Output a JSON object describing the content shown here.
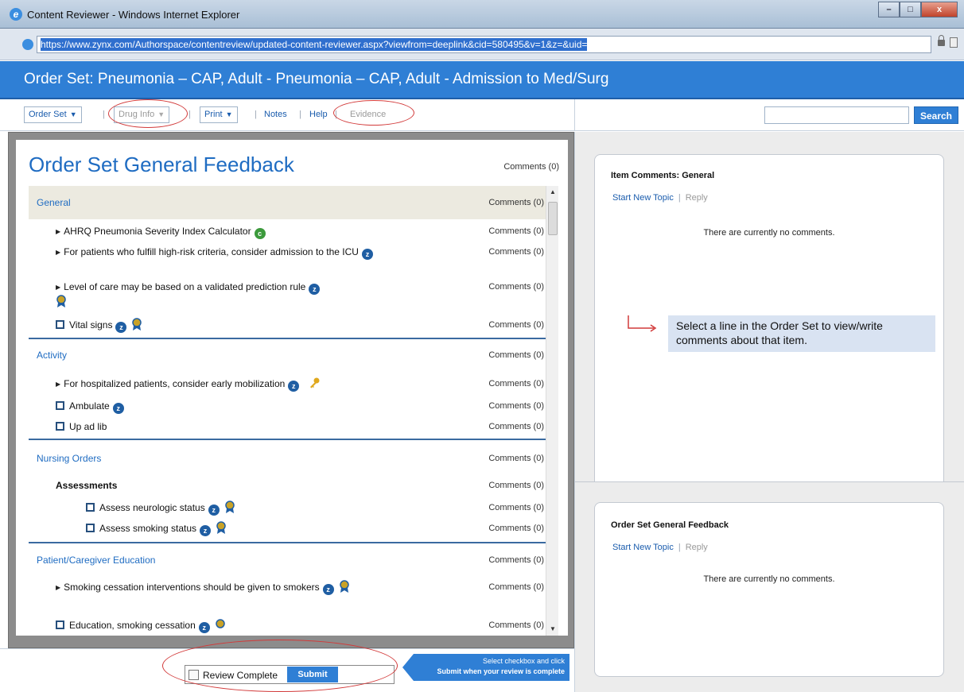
{
  "window": {
    "title": "Content Reviewer - Windows Internet Explorer",
    "url": "https://www.zynx.com/Authorspace/contentreview/updated-content-reviewer.aspx?viewfrom=deeplink&cid=580495&v=1&z=&uid=",
    "min_label": "–",
    "max_label": "□",
    "close_label": "x"
  },
  "header": {
    "title": "Order Set: Pneumonia – CAP, Adult - Pneumonia – CAP, Adult - Admission to Med/Surg"
  },
  "toolbar": {
    "order_set": "Order Set",
    "drug_info": "Drug Info",
    "print": "Print",
    "notes": "Notes",
    "help": "Help",
    "evidence": "Evidence",
    "sep": "|",
    "search_label": "Search"
  },
  "left": {
    "heading": "Order Set General Feedback",
    "heading_comments": "Comments (0)",
    "rows": [
      {
        "kind": "section",
        "text": "General",
        "comments": "Comments (0)"
      },
      {
        "kind": "item",
        "text": "AHRQ Pneumonia Severity Index Calculator",
        "comments": "Comments (0)"
      },
      {
        "kind": "item",
        "text": "For patients who fulfill high-risk criteria, consider admission to the ICU",
        "comments": "Comments (0)"
      },
      {
        "kind": "item",
        "text": "Level of care may be based on a validated prediction rule",
        "comments": "Comments (0)"
      },
      {
        "kind": "check",
        "text": "Vital signs",
        "comments": "Comments (0)"
      },
      {
        "kind": "section",
        "text": "Activity",
        "comments": "Comments (0)"
      },
      {
        "kind": "item",
        "text": "For hospitalized patients, consider early mobilization",
        "comments": "Comments (0)"
      },
      {
        "kind": "check",
        "text": "Ambulate",
        "comments": "Comments (0)"
      },
      {
        "kind": "check",
        "text": "Up ad lib",
        "comments": "Comments (0)"
      },
      {
        "kind": "section",
        "text": "Nursing Orders",
        "comments": "Comments (0)"
      },
      {
        "kind": "subhead",
        "text": "Assessments",
        "comments": "Comments (0)"
      },
      {
        "kind": "check",
        "text": "Assess neurologic status",
        "comments": "Comments (0)"
      },
      {
        "kind": "check",
        "text": "Assess smoking status",
        "comments": "Comments (0)"
      },
      {
        "kind": "section",
        "text": "Patient/Caregiver Education",
        "comments": "Comments (0)"
      },
      {
        "kind": "item",
        "text": "Smoking cessation interventions should be given to smokers",
        "comments": "Comments (0)"
      },
      {
        "kind": "check",
        "text": "Education, smoking cessation",
        "comments": "Comments (0)"
      }
    ],
    "badge_z": "z",
    "badge_c": "c"
  },
  "bottom": {
    "review_complete": "Review Complete",
    "submit": "Submit",
    "hint_line1": "Select checkbox and click",
    "hint_line2": "Submit when your review is complete"
  },
  "right": {
    "item_comments_title": "Item Comments: General",
    "start_new_topic": "Start New Topic",
    "reply": "Reply",
    "sep": "|",
    "no_comments": "There are currently no comments.",
    "callout": "Select a line in the Order Set to view/write comments about that item.",
    "feedback_title": "Order Set General Feedback"
  },
  "colors": {
    "brand_blue": "#2f7fd5",
    "link_blue": "#1a5cad",
    "annotation_red": "#d23a3a"
  }
}
